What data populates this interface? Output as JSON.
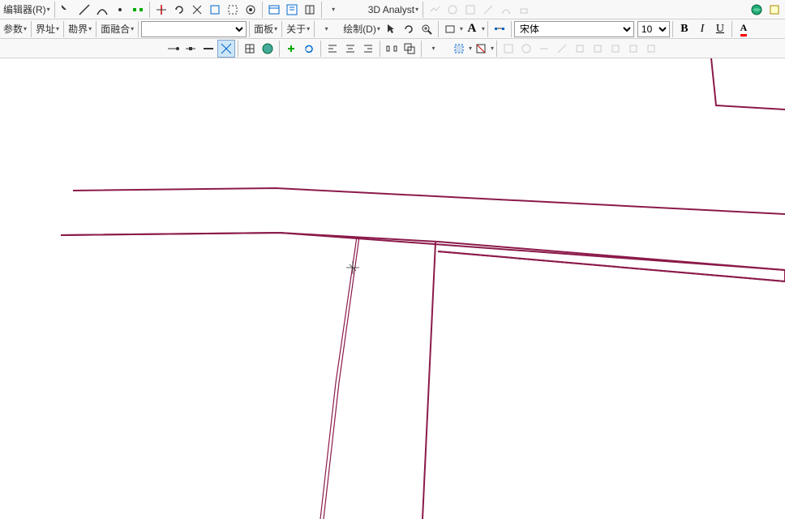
{
  "toolbar1": {
    "editor_label": "编辑器(R)",
    "analyst_label": "3D Analyst"
  },
  "toolbar2": {
    "params_label": "参数",
    "boundary_label": "界址",
    "survey_label": "勘界",
    "merge_label": "面融合",
    "panel_label": "面板",
    "about_label": "关于",
    "draw_label": "绘制(D)"
  },
  "font": {
    "name": "宋体",
    "size": "10"
  },
  "format": {
    "bold": "B",
    "italic": "I",
    "underline": "U",
    "font_color": "A"
  }
}
